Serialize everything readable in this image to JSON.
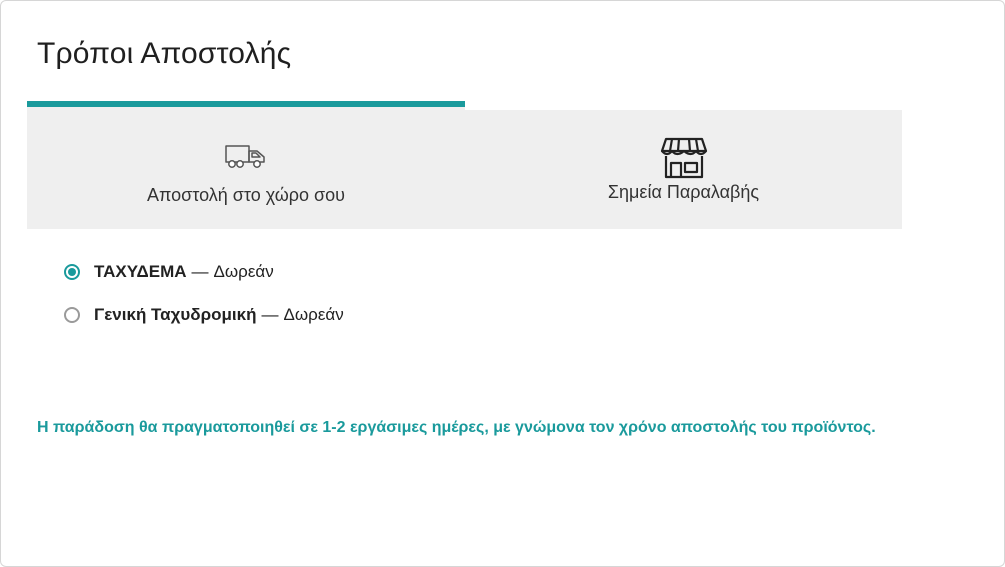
{
  "title": "Τρόποι Αποστολής",
  "tabs": [
    {
      "label": "Αποστολή στο χώρο σου",
      "icon": "delivery-truck-icon",
      "active": true
    },
    {
      "label": "Σημεία Παραλαβής",
      "icon": "storefront-icon",
      "active": false
    }
  ],
  "options": [
    {
      "name": "ΤΑΧΥΔΕΜΑ",
      "separator": "—",
      "price": "Δωρεάν",
      "selected": true
    },
    {
      "name": "Γενική Ταχυδρομική",
      "separator": "—",
      "price": "Δωρεάν",
      "selected": false
    }
  ],
  "note": "Η παράδοση θα πραγματοποιηθεί σε 1-2 εργάσιμες ημέρες, με γνώμονα τον χρόνο αποστολής του προϊόντος.",
  "colors": {
    "accent": "#1a9a9c",
    "tab_bg": "#efefef",
    "border": "#d6d6d6"
  }
}
